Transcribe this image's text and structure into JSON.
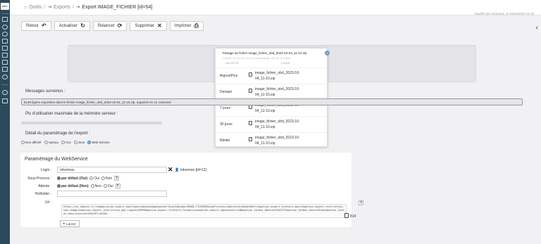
{
  "sidebar": {
    "logo_text": "INFO"
  },
  "header": {
    "collapse_glyph": "«",
    "breadcrumbs": [
      {
        "label": "Outils",
        "icon": "home-icon"
      },
      {
        "label": "Exports",
        "icon": "export-icon"
      },
      {
        "label": "Export IMAGE_FICHIER [id=54]",
        "icon": "export-icon"
      }
    ],
    "modified_info": "Modifié par mbonnas, le 04/10/2023 11:15"
  },
  "toolbar": {
    "buttons": [
      {
        "label": "Retour",
        "icon": "back-icon",
        "glyph": "↶"
      },
      {
        "label": "Actualiser",
        "icon": "refresh-icon",
        "glyph": "↻"
      },
      {
        "label": "Relancer",
        "icon": "refresh-icon",
        "glyph": "⟳"
      },
      {
        "label": "Supprimer",
        "icon": "close-icon",
        "glyph": "✕"
      },
      {
        "label": "Imprimer",
        "icon": "print-icon",
        "glyph": "⎙"
      }
    ]
  },
  "share_popup": {
    "title": "Partage du fichier image_fichier_obd_2023-10-04_11-10.zip",
    "subtitle": "Cliquez sur un lien pour le télécharger afin de le copier",
    "col_validity": "VALIDITÉ",
    "col_links": "LIENS",
    "rows": [
      {
        "validity": "Aujourd'hui",
        "link": "image_fichier_obd_2023-10-04_11-10.zip"
      },
      {
        "validity": "Demain",
        "link": "image_fichier_obd_2023-10-04_11-10.zip"
      },
      {
        "validity": "7 jours",
        "link": "image_fichier_obd_2023-10-04_11-10.zip"
      },
      {
        "validity": "30 jours",
        "link": "image_fichier_obd_2023-10-04_11-10.zip"
      },
      {
        "validity": "Illimité",
        "link": "image_fichier_obd_2023-10-04_11-10.zip"
      }
    ]
  },
  "messages": {
    "label": "Messages survenus :",
    "text": "6146 lignes exportées dans le fichier image_fichier_obd_2023-10-04_11-10.zip, organisé en 21 colonnes"
  },
  "memory": {
    "label": "Pic d'utilisation maximale de la mémoire serveur :"
  },
  "detail": {
    "label": "Détail du paramétrage de l'export :",
    "options": [
      {
        "label": "Non affiché",
        "selected": false
      },
      {
        "label": "Aperçu",
        "selected": false
      },
      {
        "label": "Csv",
        "selected": false
      },
      {
        "label": "Json",
        "selected": false
      },
      {
        "label": "Web Service",
        "selected": true
      }
    ]
  },
  "webservice": {
    "title": "Paramétrage du WebService",
    "login_label": "Login :",
    "login_value": "mbonnas",
    "login_user": "mbonnas [id=12]",
    "subprocess_label": "Sous-Process :",
    "subprocess_options": [
      "par défaut (Oui)",
      "Oui",
      "Non"
    ],
    "wait_label": "Attente :",
    "wait_options": [
      "par défaut (Non)",
      "Non",
      "Oui"
    ],
    "hotfolder_label": "Hotfolder :",
    "hotfolder_value": "",
    "url_label": "Url :",
    "url_value": "https://w1.oobase.fr/rimage/ws/ws_export.php?login=mbonnas&password=*&id=54&name=IMAGE_FICHIER&sousProcess=1&attente=0&dateRef=1&option_export_fichiers_max=1&option_export_restriction_nom_champ=1&option_export_restriction_max_lignes=99999&option_export_fichiers_format=csv&option_export_separateur=%3B&option_format_date=d%2Fm%2FY&option_format_heure=H%3Ai&option_format_date_heure=d%2Fm%2FY+H%3Ai",
    "url_count": "814",
    "help_glyph": "?",
    "launch_label": "Lancer",
    "launch_icon": "play-icon"
  },
  "right_toggle_glyph": "‹"
}
